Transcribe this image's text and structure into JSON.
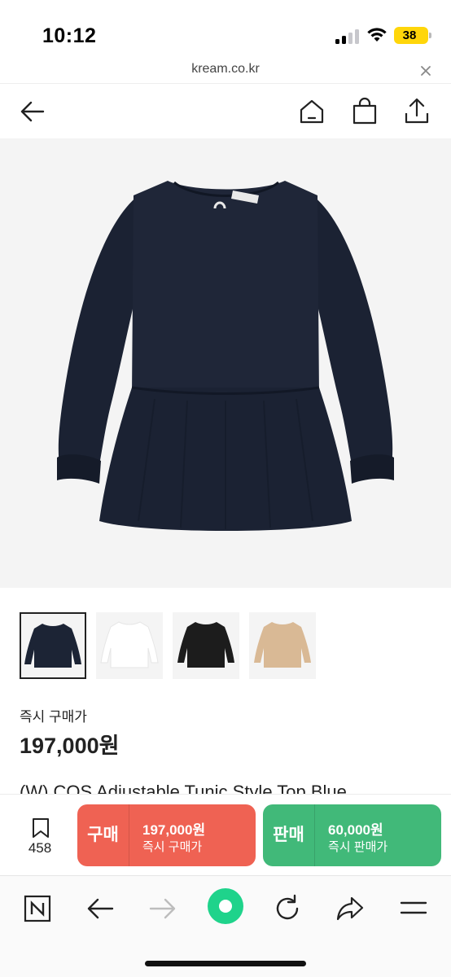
{
  "status_bar": {
    "time": "10:12",
    "battery": "38"
  },
  "browser": {
    "url": "kream.co.kr"
  },
  "icons": {
    "back": "back-arrow-icon",
    "home": "home-icon",
    "bag": "shopping-bag-icon",
    "share": "share-icon",
    "bookmark": "bookmark-icon",
    "close": "close-icon"
  },
  "product": {
    "price_label": "즉시 구매가",
    "price": "197,000원",
    "name": "(W) COS Adjustable Tunic Style Top Blue",
    "thumbnail_colors": [
      "#1c2435",
      "#ffffff",
      "#1c1c1c",
      "#d9b995"
    ]
  },
  "actions": {
    "wish_count": "458",
    "buy": {
      "label": "구매",
      "price": "197,000원",
      "caption": "즉시 구매가"
    },
    "sell": {
      "label": "판매",
      "price": "60,000원",
      "caption": "즉시 판매가"
    }
  },
  "colors": {
    "buy": "#ef6253",
    "sell": "#41b979",
    "home_indicator_accent": "#1fd38b"
  },
  "toolbar": {
    "items": [
      "naver-n-icon",
      "back-icon",
      "forward-icon",
      "green-dot-home-icon",
      "refresh-icon",
      "share-icon",
      "menu-icon"
    ]
  }
}
